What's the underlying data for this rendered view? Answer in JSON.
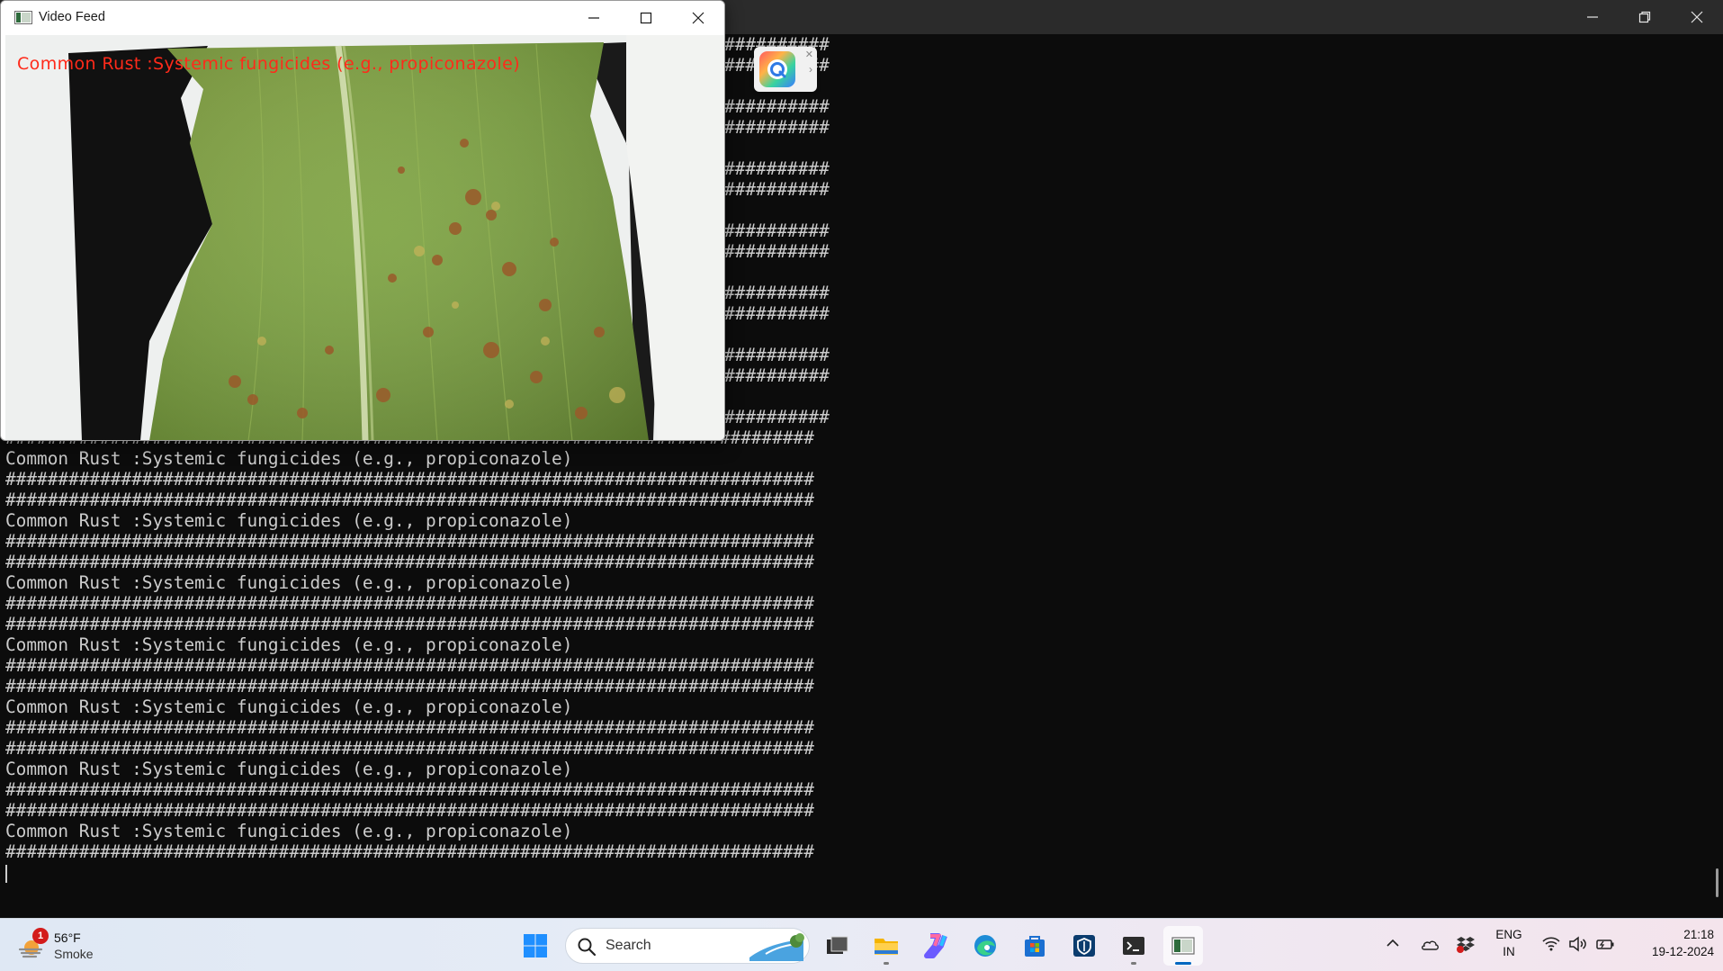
{
  "terminal": {
    "lines": [
      "##########",
      "##########",
      "",
      "##########",
      "##########",
      "",
      "##########",
      "##########",
      "",
      "##########",
      "##########",
      "",
      "##########",
      "##########",
      "",
      "##########",
      "##########",
      "",
      "##########",
      "#############################################################################",
      "Common Rust :Systemic fungicides (e.g., propiconazole)",
      "#############################################################################",
      "#############################################################################",
      "Common Rust :Systemic fungicides (e.g., propiconazole)",
      "#############################################################################",
      "#############################################################################",
      "Common Rust :Systemic fungicides (e.g., propiconazole)",
      "#############################################################################",
      "#############################################################################",
      "Common Rust :Systemic fungicides (e.g., propiconazole)",
      "#############################################################################",
      "#############################################################################",
      "Common Rust :Systemic fungicides (e.g., propiconazole)",
      "#############################################################################",
      "#############################################################################",
      "Common Rust :Systemic fungicides (e.g., propiconazole)",
      "#############################################################################",
      "#############################################################################",
      "Common Rust :Systemic fungicides (e.g., propiconazole)",
      "#############################################################################"
    ],
    "window_controls": [
      "minimize-icon",
      "restore-icon",
      "close-icon"
    ]
  },
  "video_window": {
    "title": "Video Feed",
    "overlay_text": "Common Rust :Systemic fungicides (e.g., propiconazole)",
    "overlay_color": "#ff2a1a"
  },
  "taskbar": {
    "weather": {
      "temperature": "56°F",
      "condition": "Smoke",
      "badge_count": "1"
    },
    "search_placeholder": "Search",
    "apps": [
      {
        "name": "start-icon"
      },
      {
        "name": "task-view-icon"
      },
      {
        "name": "file-explorer-icon"
      },
      {
        "name": "copilot-icon"
      },
      {
        "name": "edge-icon"
      },
      {
        "name": "store-icon"
      },
      {
        "name": "shield-app-icon"
      },
      {
        "name": "terminal-icon"
      },
      {
        "name": "video-feed-icon"
      }
    ],
    "tray": {
      "language_line1": "ENG",
      "language_line2": "IN",
      "time": "21:18",
      "date": "19-12-2024"
    }
  },
  "colors": {
    "terminal_bg": "#0c0c0c",
    "terminal_text": "#cccccc",
    "accent": "#0067c0"
  }
}
